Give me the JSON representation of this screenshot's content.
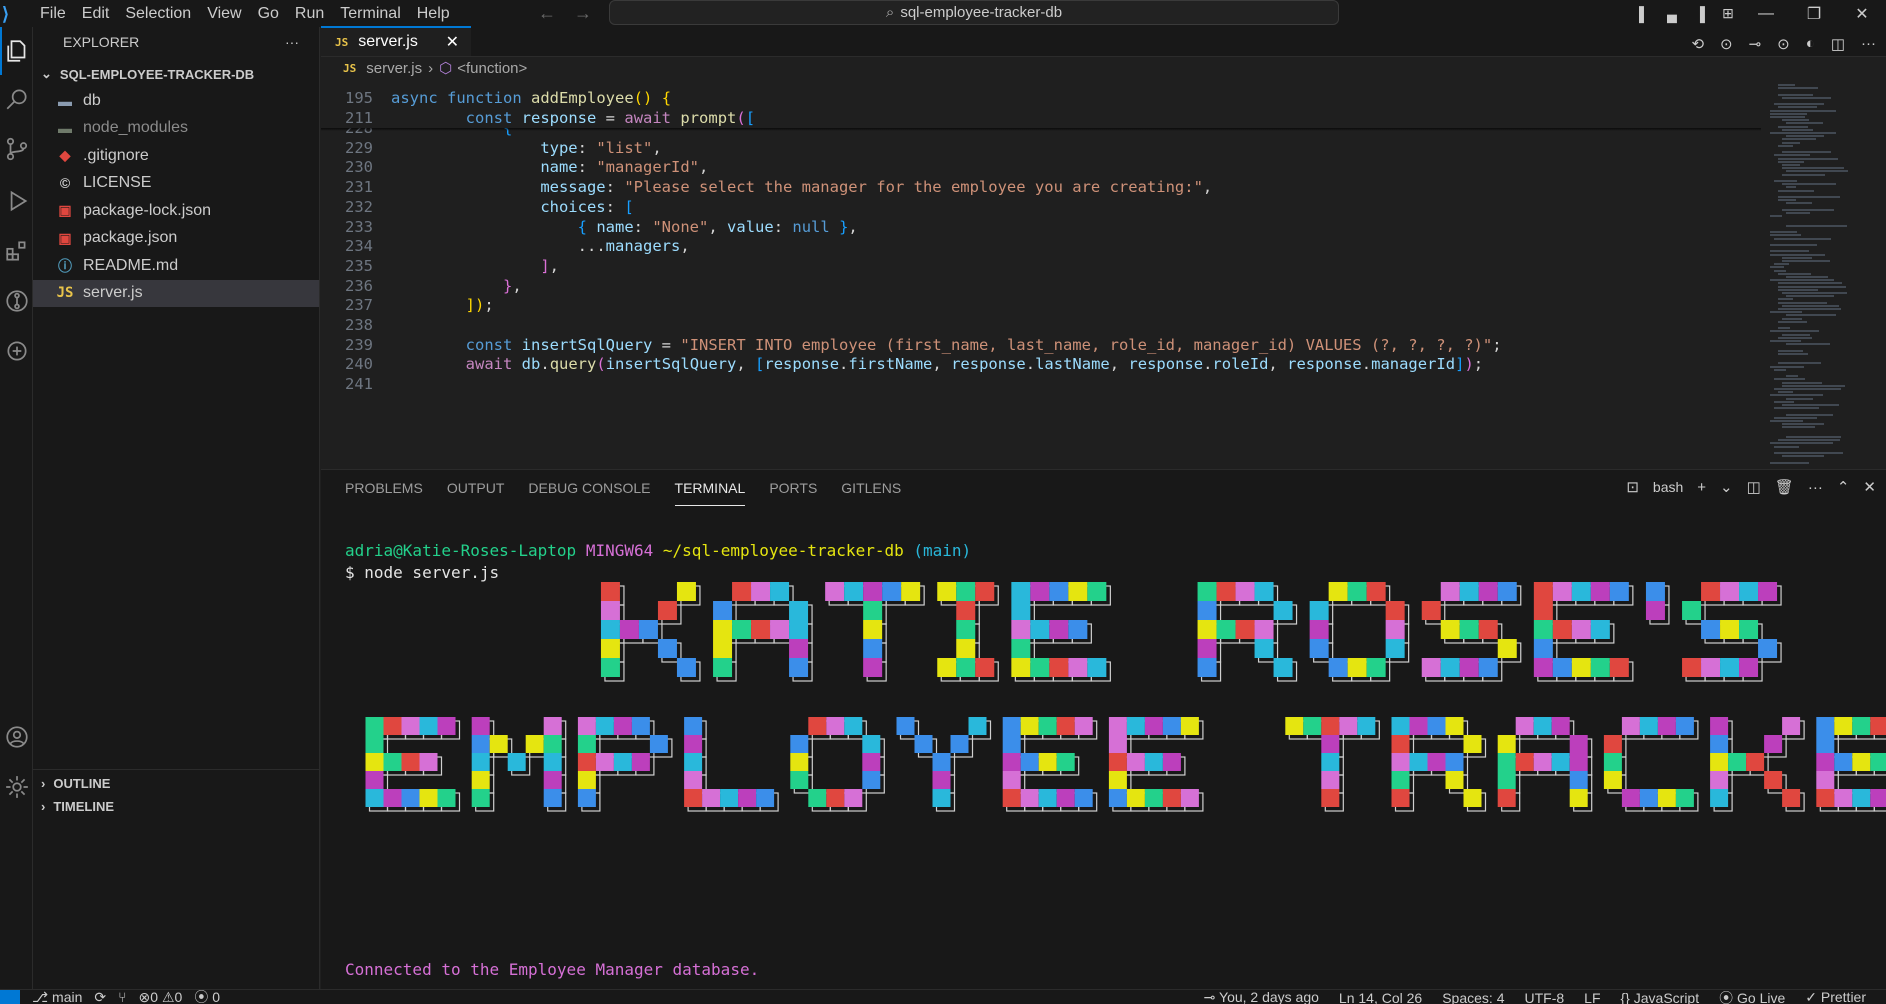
{
  "titlebar": {
    "menu": [
      "File",
      "Edit",
      "Selection",
      "View",
      "Go",
      "Run",
      "Terminal",
      "Help"
    ],
    "search": "sql-employee-tracker-db"
  },
  "sidebar": {
    "title": "EXPLORER",
    "more": "···",
    "folder": "SQL-EMPLOYEE-TRACKER-DB",
    "items": [
      {
        "label": "db",
        "icon": "folder-icon"
      },
      {
        "label": "node_modules",
        "icon": "folder-icon"
      },
      {
        "label": ".gitignore",
        "icon": "git-icon"
      },
      {
        "label": "LICENSE",
        "icon": "license-icon"
      },
      {
        "label": "package-lock.json",
        "icon": "npm-icon"
      },
      {
        "label": "package.json",
        "icon": "npm-icon"
      },
      {
        "label": "README.md",
        "icon": "info-icon"
      },
      {
        "label": "server.js",
        "icon": "js-icon"
      }
    ],
    "outline": "OUTLINE",
    "timeline": "TIMELINE"
  },
  "editor": {
    "tab_label": "server.js",
    "tab_badge": "JS",
    "breadcrumb_file": "server.js",
    "breadcrumb_symbol": "<function>",
    "sticky": [
      {
        "num": "195",
        "text": "async function addEmployee() {"
      },
      {
        "num": "211",
        "text": "        const response = await prompt(["
      }
    ],
    "lines": [
      {
        "num": "228",
        "text": "            {"
      },
      {
        "num": "229",
        "text": "                type: \"list\","
      },
      {
        "num": "230",
        "text": "                name: \"managerId\","
      },
      {
        "num": "231",
        "text": "                message: \"Please select the manager for the employee you are creating:\","
      },
      {
        "num": "232",
        "text": "                choices: ["
      },
      {
        "num": "233",
        "text": "                    { name: \"None\", value: null },"
      },
      {
        "num": "234",
        "text": "                    ...managers,"
      },
      {
        "num": "235",
        "text": "                ],"
      },
      {
        "num": "236",
        "text": "            },"
      },
      {
        "num": "237",
        "text": "        ]);"
      },
      {
        "num": "238",
        "text": ""
      },
      {
        "num": "239",
        "text": "        const insertSqlQuery = \"INSERT INTO employee (first_name, last_name, role_id, manager_id) VALUES (?, ?, ?, ?)\";"
      },
      {
        "num": "240",
        "text": "        await db.query(insertSqlQuery, [response.firstName, response.lastName, response.roleId, response.managerId]);"
      },
      {
        "num": "241",
        "text": ""
      }
    ]
  },
  "panel": {
    "tabs": [
      "PROBLEMS",
      "OUTPUT",
      "DEBUG CONSOLE",
      "TERMINAL",
      "PORTS",
      "GITLENS"
    ],
    "active_tab": "TERMINAL",
    "shell": "bash",
    "prompt_user": "adria@Katie-Roses-Laptop",
    "prompt_env": "MINGW64",
    "prompt_path": "~/sql-employee-tracker-db",
    "prompt_branch": "(main)",
    "command": "$ node server.js",
    "banner_line1": "KATIE ROSE'S",
    "banner_line2": "EMPLOYEE TRACKER",
    "connected": "Connected to the Employee Manager database."
  },
  "statusbar": {
    "branch": "main",
    "errors": "0",
    "warnings": "0",
    "ports": "0",
    "blame": "You, 2 days ago",
    "position": "Ln 14, Col 26",
    "spaces": "Spaces: 4",
    "encoding": "UTF-8",
    "eol": "LF",
    "language": "JavaScript",
    "golive": "Go Live",
    "prettier": "Prettier"
  },
  "colors": {
    "accent": "#0078d4",
    "banner_palette": [
      "#e0473f",
      "#23d18b",
      "#e5e510",
      "#3b8eea",
      "#bc3fbc",
      "#29b8db",
      "#d670d6",
      "#ffffff"
    ]
  }
}
